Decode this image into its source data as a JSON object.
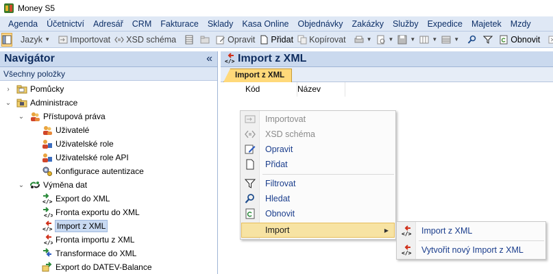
{
  "window": {
    "title": "Money S5",
    "app_icon": "money-app-icon"
  },
  "menubar": {
    "items": [
      "Agenda",
      "Účetnictví",
      "Adresář",
      "CRM",
      "Fakturace",
      "Sklady",
      "Kasa Online",
      "Objednávky",
      "Zakázky",
      "Služby",
      "Expedice",
      "Majetek",
      "Mzdy"
    ]
  },
  "toolbar": {
    "language_label": "Jazyk",
    "import_label": "Importovat",
    "xsd_label": "XSD schéma",
    "edit_label": "Opravit",
    "add_label": "Přidat",
    "copy_label": "Kopírovat",
    "refresh_label": "Obnovit"
  },
  "navigator": {
    "title": "Navigátor",
    "collapse_glyph": "«",
    "filter_label": "Všechny položky",
    "tree": [
      {
        "label": "Pomůcky",
        "icon": "folder-icon",
        "chevron": "›"
      },
      {
        "label": "Administrace",
        "icon": "admin-folder-icon",
        "chevron": "⌄"
      },
      {
        "label": "Přístupová práva",
        "icon": "users-icon",
        "chevron": "⌄"
      },
      {
        "label": "Uživatelé",
        "icon": "users-icon"
      },
      {
        "label": "Uživatelské role",
        "icon": "roles-icon"
      },
      {
        "label": "Uživatelské role API",
        "icon": "roles-icon"
      },
      {
        "label": "Konfigurace autentizace",
        "icon": "gears-icon"
      },
      {
        "label": "Výměna dat",
        "icon": "exchange-icon",
        "chevron": "⌄"
      },
      {
        "label": "Export do XML",
        "icon": "xml-export-icon"
      },
      {
        "label": "Fronta exportu do XML",
        "icon": "xml-queue-icon"
      },
      {
        "label": "Import z XML",
        "icon": "xml-import-icon",
        "selected": true
      },
      {
        "label": "Fronta importu z XML",
        "icon": "xml-queue-icon"
      },
      {
        "label": "Transformace do XML",
        "icon": "xml-transform-icon"
      },
      {
        "label": "Export do DATEV-Balance",
        "icon": "datev-icon"
      }
    ]
  },
  "content": {
    "title": "Import z XML",
    "tab": "Import z XML",
    "columns": [
      "Kód",
      "Název"
    ]
  },
  "context_menu": {
    "items": [
      {
        "label": "Importovat",
        "icon": "import-icon",
        "disabled": true
      },
      {
        "label": "XSD schéma",
        "icon": "xsd-icon",
        "disabled": true
      },
      {
        "label": "Opravit",
        "icon": "edit-icon"
      },
      {
        "label": "Přidat",
        "icon": "add-icon"
      },
      {
        "label": "Filtrovat",
        "icon": "filter-icon"
      },
      {
        "label": "Hledat",
        "icon": "search-icon"
      },
      {
        "label": "Obnovit",
        "icon": "refresh-icon"
      },
      {
        "label": "Import",
        "icon": "",
        "submenu": true
      }
    ],
    "submenu_arrow": "▶"
  },
  "submenu": {
    "items": [
      {
        "label": "Import z XML",
        "icon": "xml-import-icon"
      },
      {
        "label": "Vytvořit nový Import z XML",
        "icon": "xml-import-icon"
      }
    ]
  },
  "colors": {
    "accent": "#ffd97a",
    "header_bg": "#cad9ee",
    "menu_text": "#1a3d8c",
    "highlight": "#f7e3a3"
  }
}
